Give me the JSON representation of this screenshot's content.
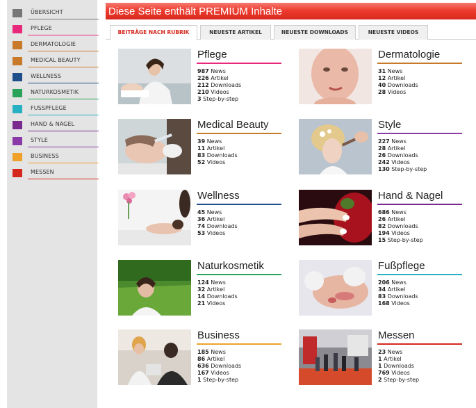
{
  "sidebar": {
    "items": [
      {
        "label": "ÜBERSICHT",
        "color": "#777777"
      },
      {
        "label": "PFLEGE",
        "color": "#e8287a"
      },
      {
        "label": "DERMATOLOGIE",
        "color": "#c9792a"
      },
      {
        "label": "MEDICAL BEAUTY",
        "color": "#c9792a"
      },
      {
        "label": "WELLNESS",
        "color": "#1f4f8a"
      },
      {
        "label": "NATURKOSMETIK",
        "color": "#2aa35a"
      },
      {
        "label": "FUSSPFLEGE",
        "color": "#27b0c2"
      },
      {
        "label": "HAND & NAGEL",
        "color": "#7a2a8e"
      },
      {
        "label": "STYLE",
        "color": "#8a3aa8"
      },
      {
        "label": "BUSINESS",
        "color": "#f0a12a"
      },
      {
        "label": "MESSEN",
        "color": "#d6271c"
      }
    ]
  },
  "banner": {
    "text": "Diese Seite enthält PREMIUM Inhalte",
    "color": "#e8362a"
  },
  "tabs": [
    {
      "label": "BEITRÄGE NACH RUBRIK",
      "active": true
    },
    {
      "label": "NEUESTE ARTIKEL",
      "active": false
    },
    {
      "label": "NEUESTE DOWNLOADS",
      "active": false
    },
    {
      "label": "NEUESTE VIDEOS",
      "active": false
    }
  ],
  "categories": [
    {
      "title": "Pflege",
      "color": "#e8287a",
      "image": "woman-facial-treatment",
      "stats": [
        {
          "n": "987",
          "t": "News"
        },
        {
          "n": "226",
          "t": "Artikel"
        },
        {
          "n": "212",
          "t": "Downloads"
        },
        {
          "n": "210",
          "t": "Videos"
        },
        {
          "n": "3",
          "t": "Step-by-step"
        }
      ]
    },
    {
      "title": "Dermatologie",
      "color": "#c9792a",
      "image": "face-closeup",
      "stats": [
        {
          "n": "31",
          "t": "News"
        },
        {
          "n": "12",
          "t": "Artikel"
        },
        {
          "n": "40",
          "t": "Downloads"
        },
        {
          "n": "28",
          "t": "Videos"
        }
      ]
    },
    {
      "title": "Medical Beauty",
      "color": "#c9792a",
      "image": "cosmetic-injection",
      "stats": [
        {
          "n": "39",
          "t": "News"
        },
        {
          "n": "11",
          "t": "Artikel"
        },
        {
          "n": "83",
          "t": "Downloads"
        },
        {
          "n": "52",
          "t": "Videos"
        }
      ]
    },
    {
      "title": "Style",
      "color": "#8a3aa8",
      "image": "bridal-makeup",
      "stats": [
        {
          "n": "227",
          "t": "News"
        },
        {
          "n": "28",
          "t": "Artikel"
        },
        {
          "n": "26",
          "t": "Downloads"
        },
        {
          "n": "242",
          "t": "Videos"
        },
        {
          "n": "130",
          "t": "Step-by-step"
        }
      ]
    },
    {
      "title": "Wellness",
      "color": "#1f4f8a",
      "image": "spa-massage",
      "stats": [
        {
          "n": "45",
          "t": "News"
        },
        {
          "n": "36",
          "t": "Artikel"
        },
        {
          "n": "74",
          "t": "Downloads"
        },
        {
          "n": "53",
          "t": "Videos"
        }
      ]
    },
    {
      "title": "Hand & Nagel",
      "color": "#7a2a8e",
      "image": "manicured-hands",
      "stats": [
        {
          "n": "686",
          "t": "News"
        },
        {
          "n": "26",
          "t": "Artikel"
        },
        {
          "n": "82",
          "t": "Downloads"
        },
        {
          "n": "194",
          "t": "Videos"
        },
        {
          "n": "15",
          "t": "Step-by-step"
        }
      ]
    },
    {
      "title": "Naturkosmetik",
      "color": "#2aa35a",
      "image": "woman-in-grass",
      "stats": [
        {
          "n": "124",
          "t": "News"
        },
        {
          "n": "32",
          "t": "Artikel"
        },
        {
          "n": "14",
          "t": "Downloads"
        },
        {
          "n": "21",
          "t": "Videos"
        }
      ]
    },
    {
      "title": "Fußpflege",
      "color": "#27b0c2",
      "image": "foot-care",
      "stats": [
        {
          "n": "206",
          "t": "News"
        },
        {
          "n": "34",
          "t": "Artikel"
        },
        {
          "n": "83",
          "t": "Downloads"
        },
        {
          "n": "168",
          "t": "Videos"
        }
      ]
    },
    {
      "title": "Business",
      "color": "#f0a12a",
      "image": "business-meeting",
      "stats": [
        {
          "n": "185",
          "t": "News"
        },
        {
          "n": "86",
          "t": "Artikel"
        },
        {
          "n": "636",
          "t": "Downloads"
        },
        {
          "n": "167",
          "t": "Videos"
        },
        {
          "n": "1",
          "t": "Step-by-step"
        }
      ]
    },
    {
      "title": "Messen",
      "color": "#d6271c",
      "image": "trade-fair-hall",
      "stats": [
        {
          "n": "23",
          "t": "News"
        },
        {
          "n": "1",
          "t": "Artikel"
        },
        {
          "n": "1",
          "t": "Downloads"
        },
        {
          "n": "769",
          "t": "Videos"
        },
        {
          "n": "2",
          "t": "Step-by-step"
        }
      ]
    }
  ]
}
